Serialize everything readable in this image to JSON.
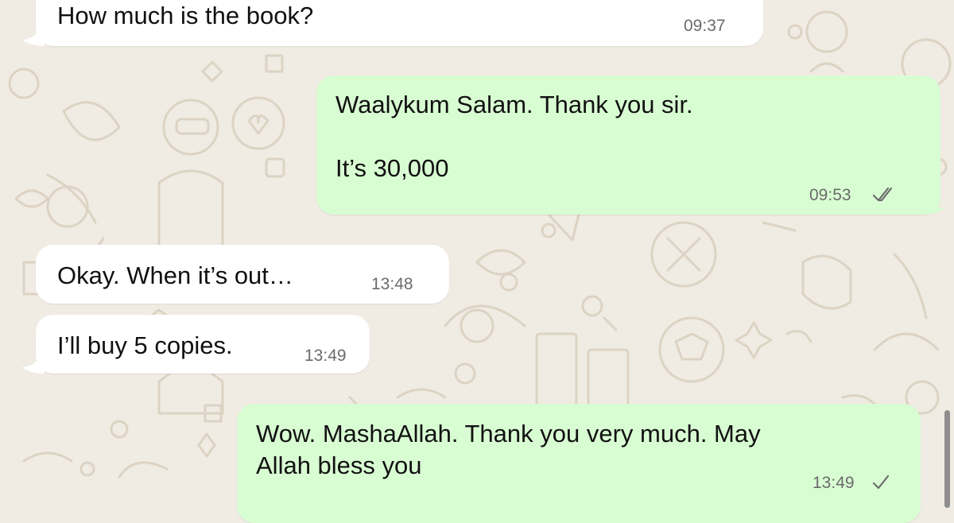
{
  "chat": {
    "background_color": "#f0ebe3",
    "incoming_color": "#ffffff",
    "outgoing_color": "#d9fdd3",
    "messages": [
      {
        "direction": "incoming",
        "text": "How much is the book?",
        "time": "09:37"
      },
      {
        "direction": "outgoing",
        "text": "Waalykum Salam. Thank you sir.\n\nIt’s 30,000",
        "time": "09:53",
        "status": "read-double-check-icon"
      },
      {
        "direction": "incoming",
        "text": "Okay. When it’s out…",
        "time": "13:48"
      },
      {
        "direction": "incoming",
        "text": "I’ll buy 5 copies.",
        "time": "13:49"
      },
      {
        "direction": "outgoing",
        "text": "Wow. MashaAllah. Thank you very much. May\nAllah bless you",
        "time": "13:49",
        "status": "sent-single-check-icon"
      }
    ]
  }
}
